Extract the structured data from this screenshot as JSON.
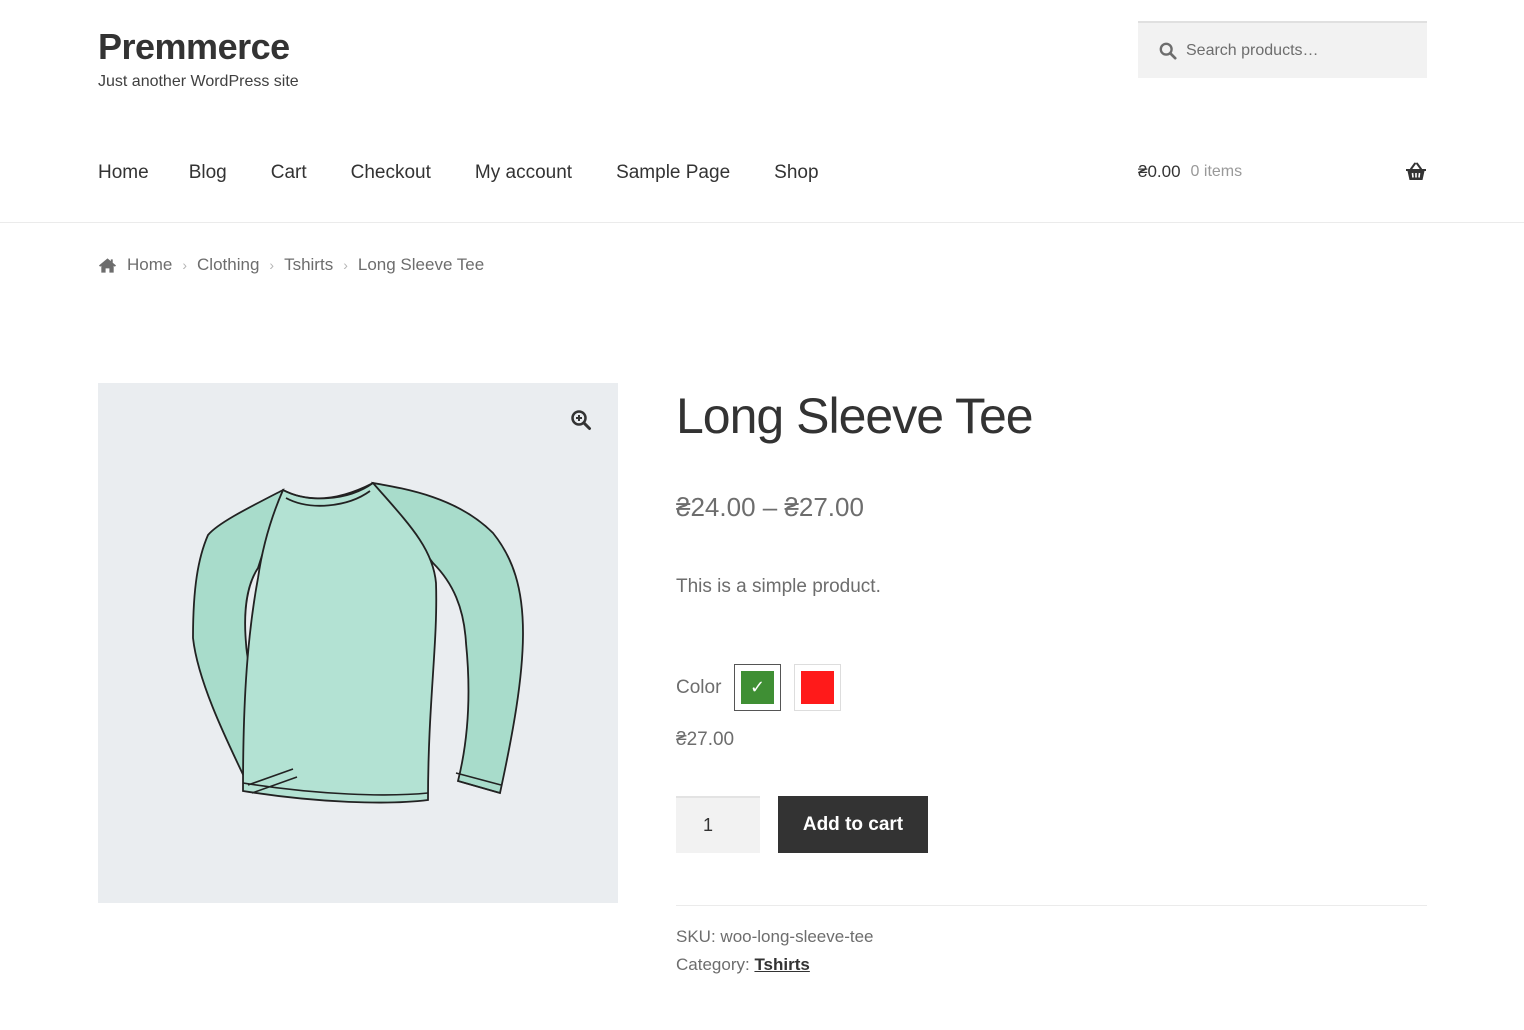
{
  "site": {
    "title": "Premmerce",
    "description": "Just another WordPress site"
  },
  "search": {
    "placeholder": "Search products…",
    "icon": "search-icon"
  },
  "nav": {
    "items": [
      {
        "label": "Home"
      },
      {
        "label": "Blog"
      },
      {
        "label": "Cart"
      },
      {
        "label": "Checkout"
      },
      {
        "label": "My account"
      },
      {
        "label": "Sample Page"
      },
      {
        "label": "Shop"
      }
    ]
  },
  "mini_cart": {
    "amount": "₴0.00",
    "count": "0 items",
    "icon": "basket-icon"
  },
  "breadcrumb": {
    "items": [
      {
        "label": "Home"
      },
      {
        "label": "Clothing"
      },
      {
        "label": "Tshirts"
      }
    ],
    "current": "Long Sleeve Tee",
    "separator": "›"
  },
  "product": {
    "title": "Long Sleeve Tee",
    "price_range": "₴24.00 – ₴27.00",
    "short_description": "This is a simple product.",
    "image_color": "#a8dccb",
    "color_attribute": {
      "label": "Color",
      "swatches": [
        {
          "color": "#3f8f34",
          "selected": true,
          "mark": "✓"
        },
        {
          "color": "#ff1a1a",
          "selected": false,
          "mark": ""
        }
      ]
    },
    "variation_price": "₴27.00",
    "quantity": "1",
    "add_to_cart_label": "Add to cart",
    "sku_label": "SKU:",
    "sku": "woo-long-sleeve-tee",
    "category_label": "Category:",
    "category": "Tshirts"
  },
  "colors": {
    "text_dark": "#333333",
    "text_body": "#6d6d6d",
    "button_bg": "#333333",
    "gallery_bg": "#eaedf0"
  }
}
